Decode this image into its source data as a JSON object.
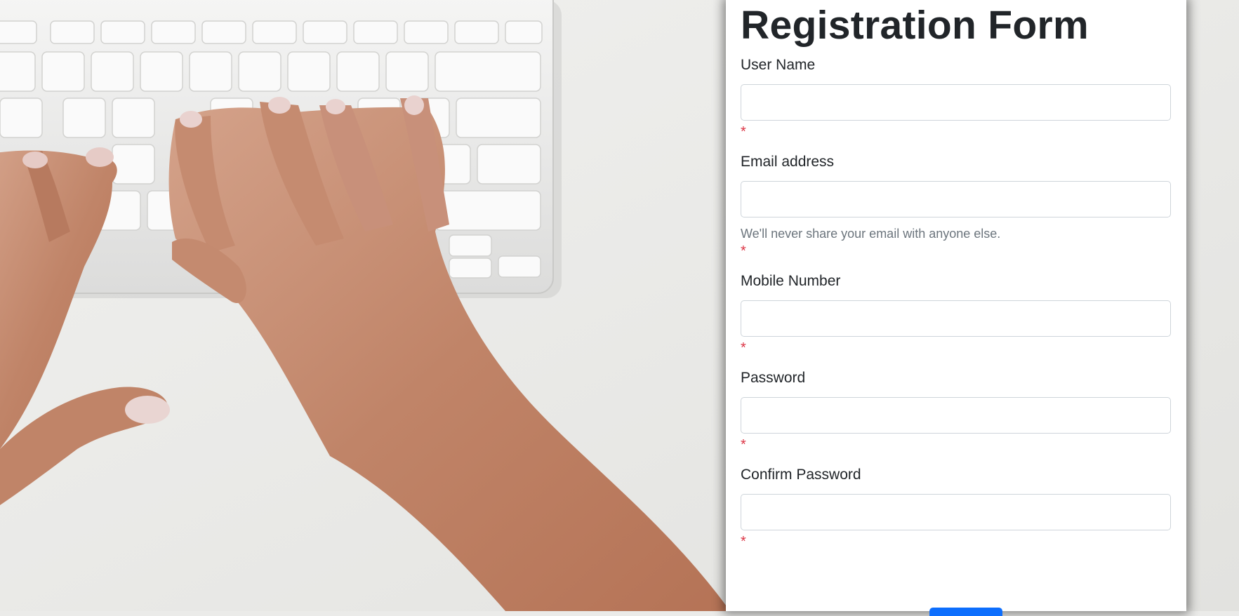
{
  "form": {
    "title": "Registration Form",
    "fields": [
      {
        "label": "User Name",
        "value": "",
        "required_mark": "*"
      },
      {
        "label": "Email address",
        "value": "",
        "help": "We'll never share your email with anyone else.",
        "required_mark": "*"
      },
      {
        "label": "Mobile Number",
        "value": "",
        "required_mark": "*"
      },
      {
        "label": "Password",
        "value": "",
        "required_mark": "*"
      },
      {
        "label": "Confirm Password",
        "value": "",
        "required_mark": "*"
      }
    ],
    "submit_label": ""
  },
  "colors": {
    "required": "#dc3545",
    "primary_button": "#0d6efd",
    "text": "#212529",
    "muted": "#6c757d"
  }
}
